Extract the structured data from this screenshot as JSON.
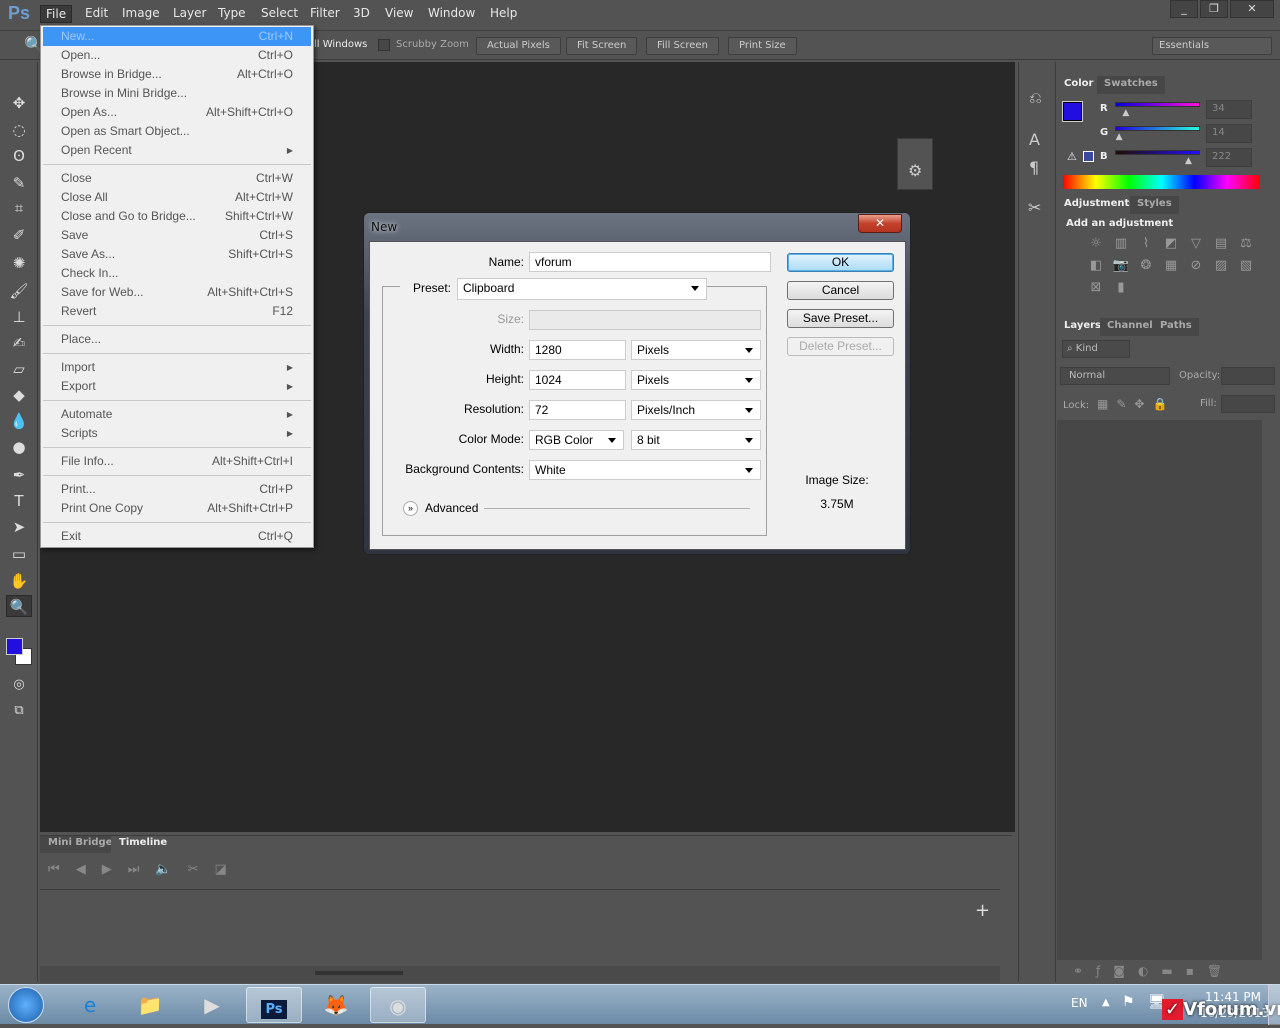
{
  "app": {
    "logo": "Ps",
    "menu": [
      "File",
      "Edit",
      "Image",
      "Layer",
      "Type",
      "Select",
      "Filter",
      "3D",
      "View",
      "Window",
      "Help"
    ],
    "window_controls": [
      "_",
      "❐",
      "✕"
    ]
  },
  "options_bar": {
    "all_windows": "ll Windows",
    "scrubby_zoom": "Scrubby Zoom",
    "actual_pixels": "Actual Pixels",
    "fit_screen": "Fit Screen",
    "fill_screen": "Fill Screen",
    "print_size": "Print Size",
    "workspace": "Essentials"
  },
  "file_menu": [
    {
      "label": "New...",
      "shortcut": "Ctrl+N",
      "highlighted": true
    },
    {
      "label": "Open...",
      "shortcut": "Ctrl+O"
    },
    {
      "label": "Browse in Bridge...",
      "shortcut": "Alt+Ctrl+O"
    },
    {
      "label": "Browse in Mini Bridge...",
      "shortcut": ""
    },
    {
      "label": "Open As...",
      "shortcut": "Alt+Shift+Ctrl+O"
    },
    {
      "label": "Open as Smart Object...",
      "shortcut": ""
    },
    {
      "label": "Open Recent",
      "shortcut": "",
      "submenu": true
    },
    {
      "sep": true
    },
    {
      "label": "Close",
      "shortcut": "Ctrl+W"
    },
    {
      "label": "Close All",
      "shortcut": "Alt+Ctrl+W"
    },
    {
      "label": "Close and Go to Bridge...",
      "shortcut": "Shift+Ctrl+W"
    },
    {
      "label": "Save",
      "shortcut": "Ctrl+S"
    },
    {
      "label": "Save As...",
      "shortcut": "Shift+Ctrl+S"
    },
    {
      "label": "Check In...",
      "shortcut": ""
    },
    {
      "label": "Save for Web...",
      "shortcut": "Alt+Shift+Ctrl+S"
    },
    {
      "label": "Revert",
      "shortcut": "F12"
    },
    {
      "sep": true
    },
    {
      "label": "Place...",
      "shortcut": ""
    },
    {
      "sep": true
    },
    {
      "label": "Import",
      "shortcut": "",
      "submenu": true
    },
    {
      "label": "Export",
      "shortcut": "",
      "submenu": true
    },
    {
      "sep": true
    },
    {
      "label": "Automate",
      "shortcut": "",
      "submenu": true
    },
    {
      "label": "Scripts",
      "shortcut": "",
      "submenu": true
    },
    {
      "sep": true
    },
    {
      "label": "File Info...",
      "shortcut": "Alt+Shift+Ctrl+I"
    },
    {
      "sep": true
    },
    {
      "label": "Print...",
      "shortcut": "Ctrl+P"
    },
    {
      "label": "Print One Copy",
      "shortcut": "Alt+Shift+Ctrl+P"
    },
    {
      "sep": true
    },
    {
      "label": "Exit",
      "shortcut": "Ctrl+Q"
    }
  ],
  "dialog": {
    "title": "New",
    "name_label": "Name:",
    "name": "vforum",
    "preset_label": "Preset:",
    "preset": "Clipboard",
    "size_label": "Size:",
    "width_label": "Width:",
    "width": "1280",
    "width_unit": "Pixels",
    "height_label": "Height:",
    "height": "1024",
    "height_unit": "Pixels",
    "resolution_label": "Resolution:",
    "resolution": "72",
    "resolution_unit": "Pixels/Inch",
    "color_mode_label": "Color Mode:",
    "color_mode": "RGB Color",
    "bit_depth": "8 bit",
    "bg_label": "Background Contents:",
    "bg": "White",
    "advanced": "Advanced",
    "ok": "OK",
    "cancel": "Cancel",
    "save_preset": "Save Preset...",
    "delete_preset": "Delete Preset...",
    "image_size_label": "Image Size:",
    "image_size": "3.75M",
    "close": "✕"
  },
  "timeline": {
    "tabs": [
      "Mini Bridge",
      "Timeline"
    ],
    "add": "+"
  },
  "color_panel": {
    "tabs": [
      "Color",
      "Swatches"
    ],
    "r_label": "R",
    "g_label": "G",
    "b_label": "B",
    "r": 34,
    "g": 14,
    "b": 222,
    "foreground": "#220ede",
    "background": "#ffffff"
  },
  "adjustments_panel": {
    "tabs": [
      "Adjustments",
      "Styles"
    ],
    "heading": "Add an adjustment"
  },
  "layers_panel": {
    "tabs": [
      "Layers",
      "Channels",
      "Paths"
    ],
    "kind": "Kind",
    "blend": "Normal",
    "opacity_label": "Opacity:",
    "lock_label": "Lock:",
    "fill_label": "Fill:"
  },
  "taskbar": {
    "lang": "EN",
    "time": "11:41 PM",
    "date": "10/29/2013",
    "watermark": "Vforum.vn"
  }
}
